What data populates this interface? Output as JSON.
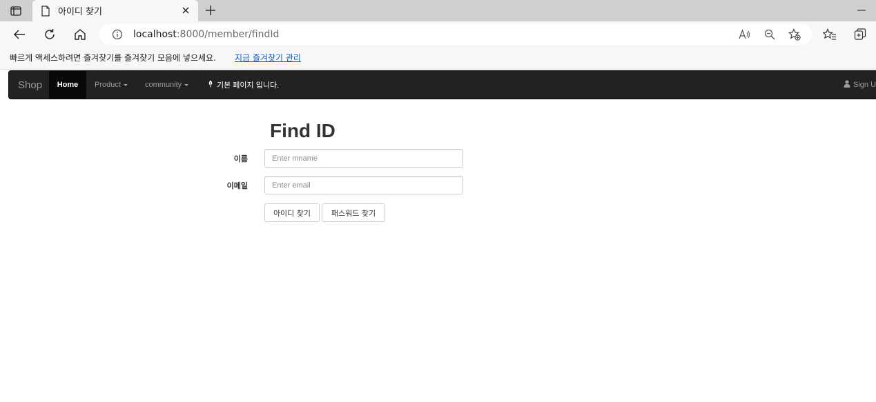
{
  "browser": {
    "tab_title": "아이디 찾기",
    "url_host": "localhost",
    "url_path": ":8000/member/findId",
    "favorites_prompt": "빠르게 액세스하려면 즐겨찾기를 즐겨찾기 모음에 넣으세요.",
    "favorites_link": "지금 즐겨찾기 관리"
  },
  "navbar": {
    "brand": "Shop",
    "items": [
      {
        "label": "Home",
        "active": true
      },
      {
        "label": "Product",
        "dropdown": true
      },
      {
        "label": "community",
        "dropdown": true
      }
    ],
    "message": "기본 페이지 입니다.",
    "sign_up": "Sign U"
  },
  "form": {
    "title": "Find ID",
    "name_label": "이름",
    "name_placeholder": "Enter mname",
    "email_label": "이메일",
    "email_placeholder": "Enter email",
    "find_id_button": "아이디 찾기",
    "find_password_button": "패스워드 찾기"
  },
  "icons": {
    "tab_actions": "tab-actions-icon",
    "document": "document-icon",
    "close": "close-icon",
    "new_tab": "plus-icon",
    "back": "back-arrow-icon",
    "refresh": "refresh-icon",
    "home": "home-icon",
    "info": "info-icon",
    "read_aloud": "read-aloud-icon",
    "zoom": "zoom-out-icon",
    "add_favorite": "star-add-icon",
    "favorites": "favorites-icon",
    "collections": "collections-icon",
    "leaf": "leaf-icon",
    "user": "user-icon"
  },
  "colors": {
    "navbar_bg": "#222222",
    "navbar_active_bg": "#080808",
    "link": "#0b5fc4"
  }
}
